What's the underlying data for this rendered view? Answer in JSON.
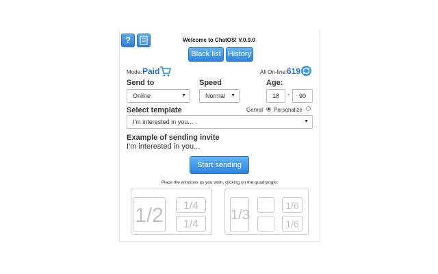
{
  "header": {
    "help_label": "?",
    "title": "Welcome to ChatOS! V.0.9.0",
    "blacklist_label": "Black list",
    "history_label": "History"
  },
  "status": {
    "mode_label": "Mode:",
    "mode_value": "Paid",
    "online_label": "All On-line:",
    "online_count": "619"
  },
  "form": {
    "send_to_label": "Send to",
    "send_to_value": "Online",
    "speed_label": "Speed",
    "speed_value": "Normal",
    "age_label": "Age:",
    "age_min": "18",
    "age_sep": "-",
    "age_max": "90",
    "template_label": "Select template",
    "radio_general": "Genral",
    "radio_personalize": "Personalize",
    "radio_selected": "general",
    "template_value": "I'm interested in you...",
    "example_label": "Example of sending invite",
    "example_text": "I'm interested in you...",
    "start_label": "Start sending"
  },
  "layout": {
    "instruction": "Place the windows as you wish, clicking on the quadrangle:",
    "g1": {
      "half": "1/2",
      "q1": "1/4",
      "q2": "1/4"
    },
    "g2": {
      "third": "1/3",
      "s1": "1/6",
      "s2": "1/6"
    }
  },
  "colors": {
    "accent": "#2b84dc",
    "brand_blue": "#1f6fc9"
  },
  "icons": {
    "cart": "cart-icon",
    "refresh": "refresh-icon",
    "notes": "notes-icon"
  }
}
